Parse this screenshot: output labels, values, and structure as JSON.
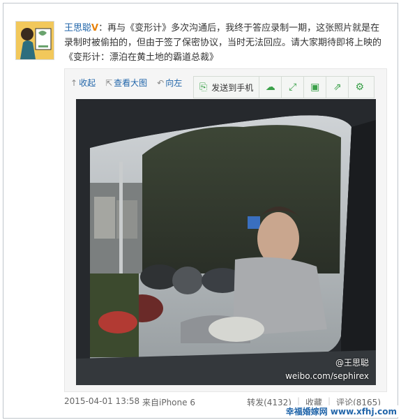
{
  "post": {
    "author": "王思聪",
    "verified_badge": "V",
    "colon": "：",
    "text": "再与《变形计》多次沟通后，我终于答应录制一期，这张照片就是在录制时被偷拍的，但由于签了保密协议，当时无法回应。请大家期待即将上映的《变形计：漂泊在黄土地的霸道总裁》"
  },
  "media_tools": {
    "collapse": "收起",
    "view_large": "查看大图",
    "rotate": "向左"
  },
  "float_toolbar": {
    "send_to_phone": "发送到手机",
    "icons": [
      "cloud-icon",
      "expand-icon",
      "save-icon",
      "share-icon",
      "settings-icon"
    ]
  },
  "photo": {
    "watermark_user": "@王思聪",
    "watermark_url": "weibo.com/sephirex"
  },
  "footer": {
    "time": "2015-04-01 13:58",
    "source": "来自iPhone 6",
    "repost": "转发(4132)",
    "favorite": "收藏",
    "comment": "评论(8165)"
  },
  "site_watermark": "幸福婚嫁网 www.xfhj.com",
  "colors": {
    "link": "#2266aa",
    "toolbar_green": "#3aa049",
    "badge": "#e8820a"
  }
}
